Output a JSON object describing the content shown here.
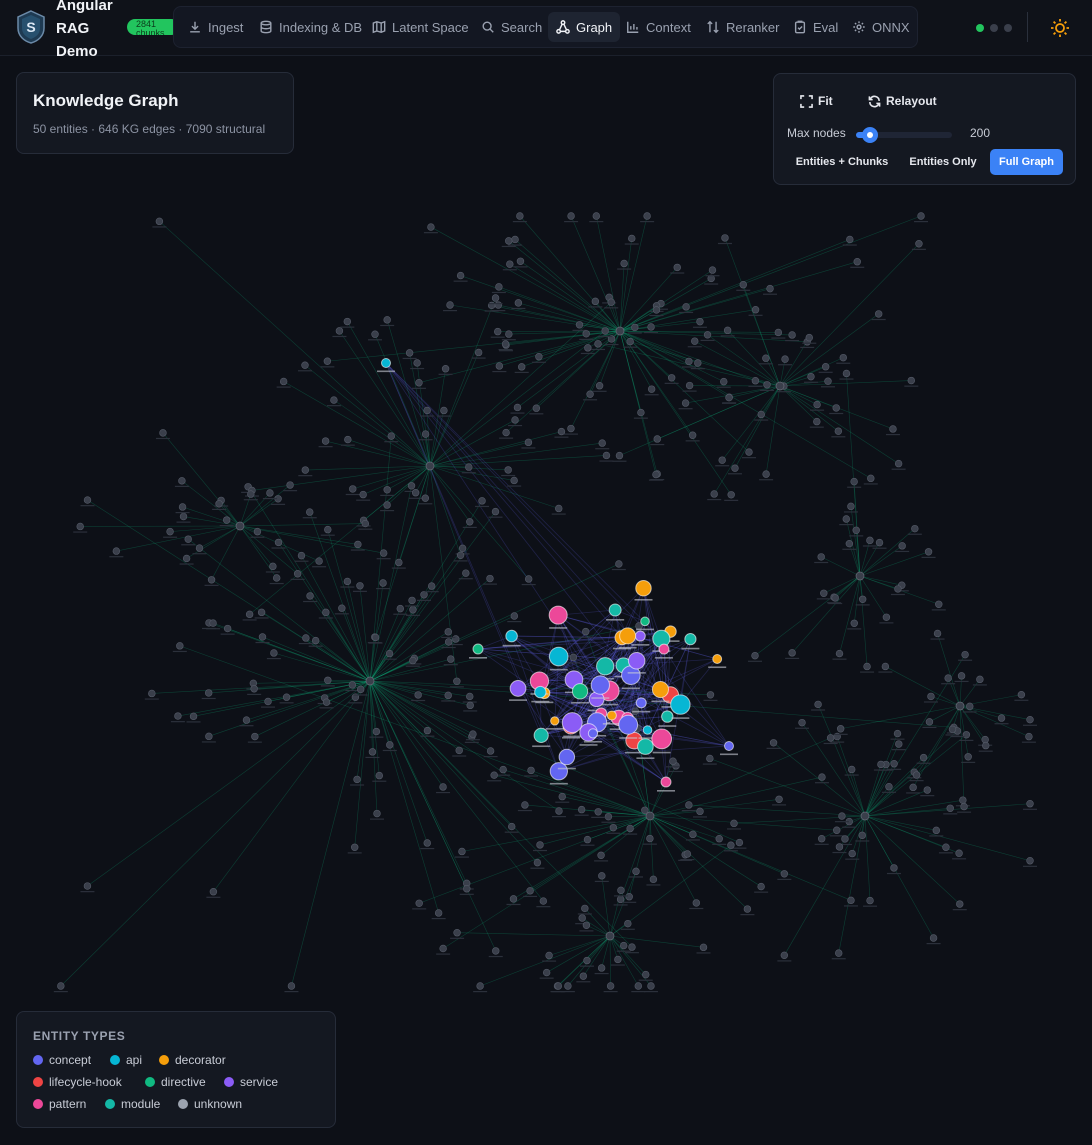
{
  "app": {
    "title": "Angular RAG Demo",
    "title_lines": [
      "Angular",
      "RAG",
      "Demo"
    ],
    "chunk_badge": "2841\nchunks",
    "status_dots": [
      "#22c55e",
      "#3a3f4b",
      "#3a3f4b"
    ],
    "accent": "#3b82f6"
  },
  "nav": {
    "tabs": [
      {
        "label": "Ingest",
        "icon": "download-icon",
        "active": false
      },
      {
        "label": "Indexing & DB",
        "icon": "database-icon",
        "active": false
      },
      {
        "label": "Latent Space",
        "icon": "map-icon",
        "active": false
      },
      {
        "label": "Search",
        "icon": "search-icon",
        "active": false
      },
      {
        "label": "Graph",
        "icon": "graph-icon",
        "active": true
      },
      {
        "label": "Context",
        "icon": "bar-chart-icon",
        "active": false
      },
      {
        "label": "Reranker",
        "icon": "sort-arrows-icon",
        "active": false
      },
      {
        "label": "Eval",
        "icon": "clipboard-check-icon",
        "active": false
      },
      {
        "label": "ONNX",
        "icon": "gear-icon",
        "active": false
      }
    ],
    "theme_toggle_icon": "sun-icon"
  },
  "kg_panel": {
    "title": "Knowledge Graph",
    "stats": "50 entities · 646 KG edges · 7090 structural"
  },
  "controls": {
    "fit_label": "Fit",
    "fit_icon": "expand-icon",
    "relayout_label": "Relayout",
    "relayout_icon": "refresh-icon",
    "max_nodes_label": "Max nodes",
    "max_nodes_value": "200",
    "max_nodes_fraction": 0.12,
    "modes": [
      {
        "label": "Entities + Chunks",
        "active": false
      },
      {
        "label": "Entities Only",
        "active": false
      },
      {
        "label": "Full Graph",
        "active": true
      }
    ]
  },
  "legend": {
    "title": "ENTITY TYPES",
    "items": [
      {
        "label": "concept",
        "color": "#6366f1"
      },
      {
        "label": "api",
        "color": "#06b6d4"
      },
      {
        "label": "decorator",
        "color": "#f59e0b"
      },
      {
        "label": "lifecycle-hook",
        "color": "#ef4444"
      },
      {
        "label": "directive",
        "color": "#10b981"
      },
      {
        "label": "service",
        "color": "#8b5cf6"
      },
      {
        "label": "pattern",
        "color": "#ec4899"
      },
      {
        "label": "module",
        "color": "#14b8a6"
      },
      {
        "label": "unknown",
        "color": "#9ca3af"
      }
    ]
  },
  "graph": {
    "chunk_color": "#3a3f4b",
    "structural_edge_color": "#10b981",
    "kg_edge_color": "#6366f1"
  }
}
